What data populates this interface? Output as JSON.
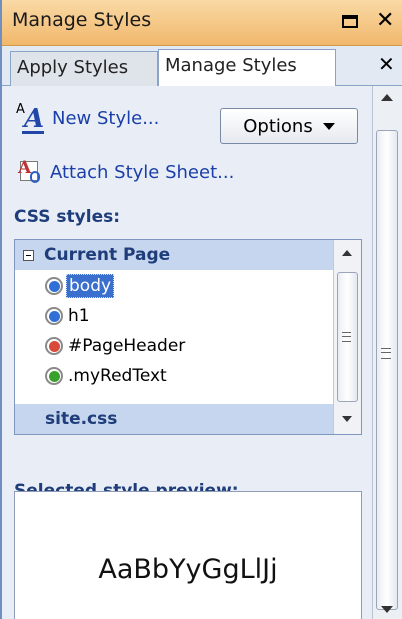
{
  "window": {
    "title": "Manage Styles"
  },
  "tabs": [
    {
      "label": "Apply Styles",
      "active": false
    },
    {
      "label": "Manage Styles",
      "active": true
    }
  ],
  "toolbar": {
    "new_style_label": "New Style...",
    "options_label": "Options",
    "attach_label": "Attach Style Sheet..."
  },
  "css_styles": {
    "section_label": "CSS styles:",
    "groups": [
      {
        "name": "Current Page",
        "expanded": true,
        "items": [
          {
            "label": "body",
            "dot_color": "#2f6fd6",
            "selected": true
          },
          {
            "label": "h1",
            "dot_color": "#2f6fd6",
            "selected": false
          },
          {
            "label": "#PageHeader",
            "dot_color": "#d84a3a",
            "selected": false
          },
          {
            "label": ".myRedText",
            "dot_color": "#3aa12c",
            "selected": false
          }
        ]
      },
      {
        "name": "site.css",
        "expanded": false,
        "items": []
      }
    ]
  },
  "preview": {
    "section_label": "Selected style preview:",
    "sample_text": "AaBbYyGgLlJj"
  },
  "colors": {
    "titlebar": "#f1b86c",
    "link": "#1a3fa8",
    "section_heading": "#1e3d7a",
    "group_header_bg": "#c6d6ee",
    "selection": "#3a6fce"
  }
}
